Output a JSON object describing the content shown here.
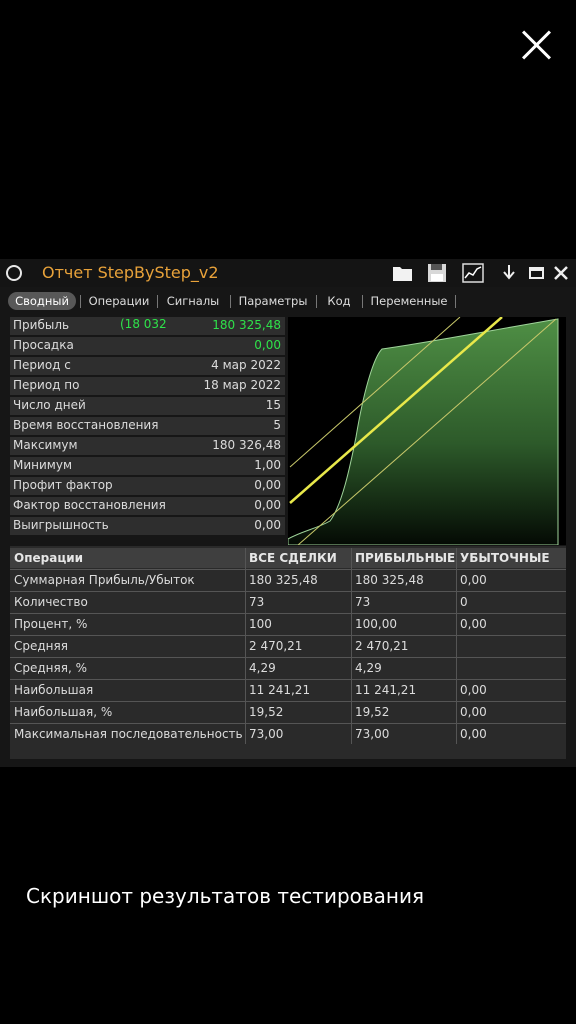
{
  "window_title": "Отчет StepByStep_v2",
  "tabs": [
    "Сводный",
    "Операции",
    "Сигналы",
    "Параметры",
    "Код",
    "Переменные"
  ],
  "stats": [
    {
      "label": "Прибыль",
      "extra": "(18 032",
      "value": "180 325,48",
      "green": true
    },
    {
      "label": "Просадка",
      "value": "0,00",
      "green": true
    },
    {
      "label": "Период с",
      "value": "4 мар 2022"
    },
    {
      "label": "Период по",
      "value": "18 мар 2022"
    },
    {
      "label": "Число дней",
      "value": "15"
    },
    {
      "label": "Время восстановления",
      "value": "5"
    },
    {
      "label": "Максимум",
      "value": "180 326,48"
    },
    {
      "label": "Минимум",
      "value": "1,00"
    },
    {
      "label": "Профит фактор",
      "value": "0,00"
    },
    {
      "label": "Фактор восстановления",
      "value": "0,00"
    },
    {
      "label": "Выигрышность",
      "value": "0,00"
    }
  ],
  "ops_headers": [
    "Операции",
    "ВСЕ СДЕЛКИ",
    "ПРИБЫЛЬНЫЕ",
    "УБЫТОЧНЫЕ"
  ],
  "ops_rows": [
    [
      "Суммарная Прибыль/Убыток",
      "180 325,48",
      "180 325,48",
      "0,00"
    ],
    [
      "Количество",
      "73",
      "73",
      "0"
    ],
    [
      "Процент, %",
      "100",
      "100,00",
      "0,00"
    ],
    [
      "Средняя",
      "2 470,21",
      "2 470,21",
      ""
    ],
    [
      "Средняя, %",
      "4,29",
      "4,29",
      ""
    ],
    [
      "Наибольшая",
      "11 241,21",
      "11 241,21",
      "0,00"
    ],
    [
      "Наибольшая, %",
      "19,52",
      "19,52",
      "0,00"
    ],
    [
      "Максимальная последовательность",
      "73,00",
      "73,00",
      "0,00"
    ]
  ],
  "caption": "Скриншот результатов тестирования",
  "icons": [
    "close-icon",
    "window-circle-icon",
    "folder-icon",
    "save-icon",
    "chart-export-icon",
    "download-icon",
    "maximize-icon",
    "window-close-icon"
  ],
  "colors": {
    "title": "#e8a23a",
    "green": "#2ee24a",
    "equity_fill": "#4f8f45",
    "trend_line": "#e8e84a"
  }
}
